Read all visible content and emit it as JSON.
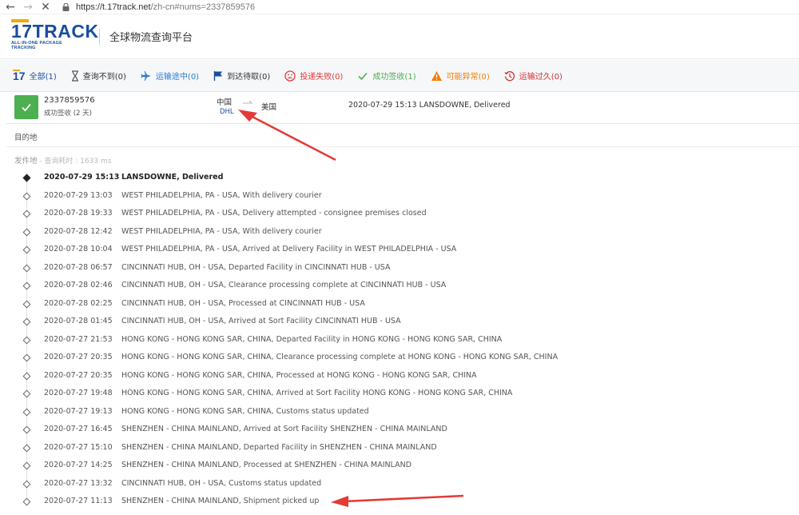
{
  "browser": {
    "url_host": "https://t.17track.net",
    "url_path": "/zh-cn#nums=2337859576"
  },
  "header": {
    "logo_main": "TRACK",
    "logo_num": "17",
    "logo_sub": "ALL-IN-ONE PACKAGE TRACKING",
    "platform_title": "全球物流查询平台"
  },
  "tabs": [
    {
      "label": "全部(1)"
    },
    {
      "label": "查询不到(0)"
    },
    {
      "label": "运输途中(0)"
    },
    {
      "label": "到达待取(0)"
    },
    {
      "label": "投递失败(0)"
    },
    {
      "label": "成功签收(1)"
    },
    {
      "label": "可能异常(0)"
    },
    {
      "label": "运输过久(0)"
    }
  ],
  "tab_colors": {
    "all": "#1a4e9e",
    "not_found": "#555555",
    "in_transit": "#2b7bd6",
    "pickup": "#1a4e9e",
    "failed": "#e53935",
    "delivered": "#4caf50",
    "alert": "#f57c00",
    "expired": "#d32f2f"
  },
  "package": {
    "number": "2337859576",
    "status": "成功签收 (2 天)",
    "origin": "中国",
    "carrier": "DHL",
    "destination": "美国",
    "latest_event": "2020-07-29 15:13  LANSDOWNE, Delivered"
  },
  "sections": {
    "destination_label": "目的地",
    "origin_label": "发件地",
    "query_time": " - 查询耗时 : 1633 ms"
  },
  "events": [
    {
      "datetime": "2020-07-29 15:13",
      "desc": "LANSDOWNE, Delivered"
    },
    {
      "datetime": "2020-07-29 13:03",
      "desc": "WEST PHILADELPHIA, PA - USA, With delivery courier"
    },
    {
      "datetime": "2020-07-28 19:33",
      "desc": "WEST PHILADELPHIA, PA - USA, Delivery attempted - consignee premises closed"
    },
    {
      "datetime": "2020-07-28 12:42",
      "desc": "WEST PHILADELPHIA, PA - USA, With delivery courier"
    },
    {
      "datetime": "2020-07-28 10:04",
      "desc": "WEST PHILADELPHIA, PA - USA, Arrived at Delivery Facility in WEST PHILADELPHIA - USA"
    },
    {
      "datetime": "2020-07-28 06:57",
      "desc": "CINCINNATI HUB, OH - USA, Departed Facility in CINCINNATI HUB - USA"
    },
    {
      "datetime": "2020-07-28 02:46",
      "desc": "CINCINNATI HUB, OH - USA, Clearance processing complete at CINCINNATI HUB - USA"
    },
    {
      "datetime": "2020-07-28 02:25",
      "desc": "CINCINNATI HUB, OH - USA, Processed at CINCINNATI HUB - USA"
    },
    {
      "datetime": "2020-07-28 01:45",
      "desc": "CINCINNATI HUB, OH - USA, Arrived at Sort Facility CINCINNATI HUB - USA"
    },
    {
      "datetime": "2020-07-27 21:53",
      "desc": "HONG KONG - HONG KONG SAR, CHINA, Departed Facility in HONG KONG - HONG KONG SAR, CHINA"
    },
    {
      "datetime": "2020-07-27 20:35",
      "desc": "HONG KONG - HONG KONG SAR, CHINA, Clearance processing complete at HONG KONG - HONG KONG SAR, CHINA"
    },
    {
      "datetime": "2020-07-27 20:35",
      "desc": "HONG KONG - HONG KONG SAR, CHINA, Processed at HONG KONG - HONG KONG SAR, CHINA"
    },
    {
      "datetime": "2020-07-27 19:48",
      "desc": "HONG KONG - HONG KONG SAR, CHINA, Arrived at Sort Facility HONG KONG - HONG KONG SAR, CHINA"
    },
    {
      "datetime": "2020-07-27 19:13",
      "desc": "HONG KONG - HONG KONG SAR, CHINA, Customs status updated"
    },
    {
      "datetime": "2020-07-27 16:45",
      "desc": "SHENZHEN - CHINA MAINLAND, Arrived at Sort Facility SHENZHEN - CHINA MAINLAND"
    },
    {
      "datetime": "2020-07-27 15:10",
      "desc": "SHENZHEN - CHINA MAINLAND, Departed Facility in SHENZHEN - CHINA MAINLAND"
    },
    {
      "datetime": "2020-07-27 14:25",
      "desc": "SHENZHEN - CHINA MAINLAND, Processed at SHENZHEN - CHINA MAINLAND"
    },
    {
      "datetime": "2020-07-27 13:32",
      "desc": "CINCINNATI HUB, OH - USA, Customs status updated"
    },
    {
      "datetime": "2020-07-27 11:13",
      "desc": "SHENZHEN - CHINA MAINLAND, Shipment picked up"
    }
  ],
  "annotation_color": "#e53935"
}
